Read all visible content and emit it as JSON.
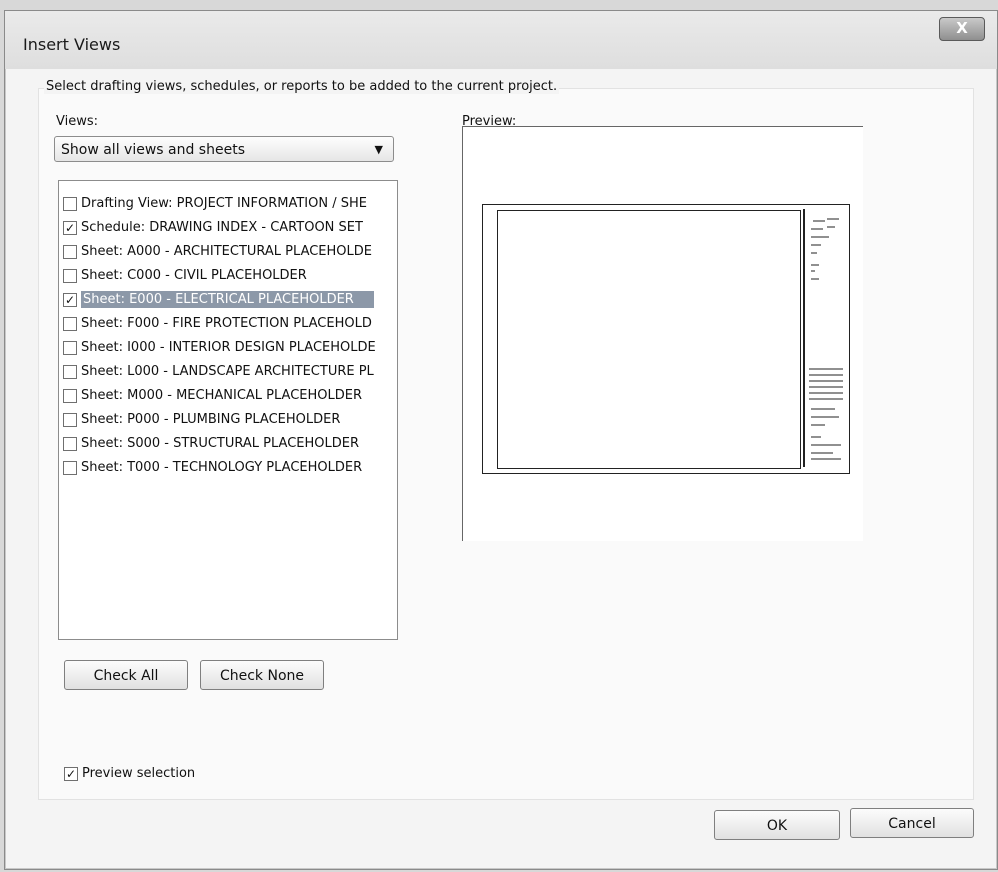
{
  "window": {
    "title": "Insert Views",
    "close_label": "X"
  },
  "instruction": "Select drafting views, schedules, or reports to be added to the current project.",
  "views": {
    "label": "Views:",
    "filter_value": "Show all views and sheets",
    "items": [
      {
        "label": "Drafting View: PROJECT INFORMATION / SHE",
        "checked": false,
        "mark": ""
      },
      {
        "label": "Schedule: DRAWING INDEX - CARTOON SET",
        "checked": true,
        "mark": "✓"
      },
      {
        "label": "Sheet: A000 - ARCHITECTURAL PLACEHOLDE",
        "checked": false,
        "mark": ""
      },
      {
        "label": "Sheet: C000 - CIVIL PLACEHOLDER",
        "checked": false,
        "mark": ""
      },
      {
        "label": "Sheet: E000 - ELECTRICAL PLACEHOLDER",
        "checked": true,
        "mark": "✓",
        "selected": true
      },
      {
        "label": "Sheet: F000 - FIRE PROTECTION PLACEHOLD",
        "checked": false,
        "mark": ""
      },
      {
        "label": "Sheet: I000 - INTERIOR DESIGN PLACEHOLDE",
        "checked": false,
        "mark": ""
      },
      {
        "label": "Sheet: L000 - LANDSCAPE ARCHITECTURE PL",
        "checked": false,
        "mark": ""
      },
      {
        "label": "Sheet: M000 - MECHANICAL PLACEHOLDER",
        "checked": false,
        "mark": ""
      },
      {
        "label": "Sheet: P000 - PLUMBING PLACEHOLDER",
        "checked": false,
        "mark": ""
      },
      {
        "label": "Sheet: S000 - STRUCTURAL PLACEHOLDER",
        "checked": false,
        "mark": ""
      },
      {
        "label": "Sheet: T000 - TECHNOLOGY PLACEHOLDER",
        "checked": false,
        "mark": ""
      }
    ],
    "check_all_label": "Check All",
    "check_none_label": "Check None"
  },
  "preview": {
    "label": "Preview:"
  },
  "preview_selection": {
    "label": "Preview selection",
    "checked": true,
    "mark": "✓"
  },
  "footer": {
    "ok_label": "OK",
    "cancel_label": "Cancel"
  }
}
